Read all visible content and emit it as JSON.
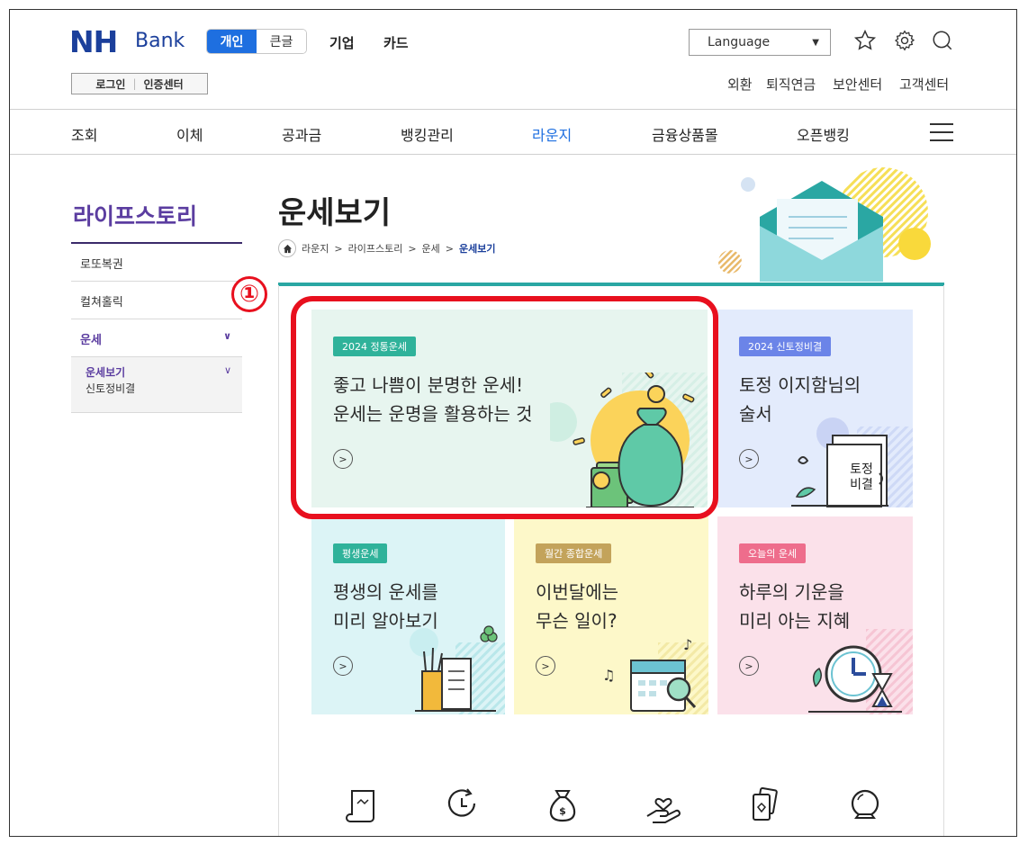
{
  "header": {
    "logo_nh": "NH",
    "logo_bank": "Bank",
    "mode_personal": "개인",
    "mode_large_text": "큰글",
    "top_links": [
      "기업",
      "카드"
    ],
    "login": "로그인",
    "cert_center": "인증센터",
    "language": "Language",
    "util_links": [
      "외환",
      "퇴직연금",
      "보안센터",
      "고객센터"
    ]
  },
  "gnb": {
    "items": [
      "조회",
      "이체",
      "공과금",
      "뱅킹관리",
      "라운지",
      "금융상품몰",
      "오픈뱅킹"
    ],
    "active": "라운지"
  },
  "sidebar": {
    "title": "라이프스토리",
    "items": [
      "로또복권",
      "컬쳐홀릭",
      "운세"
    ],
    "sub_items": [
      "운세보기",
      "신토정비결"
    ]
  },
  "main": {
    "title": "운세보기",
    "breadcrumb": [
      "라운지",
      "라이프스토리",
      "운세",
      "운세보기"
    ],
    "annotation_number": "①",
    "cards": [
      {
        "badge": "2024 정통운세",
        "text": "좋고 나쁨이 분명한 운세!\n운세는 운명을 활용하는 것",
        "bg": "#e7f5ef",
        "badge_color": "#2fb29a"
      },
      {
        "badge": "2024 신토정비결",
        "text": "토정 이지함님의\n술서",
        "bg": "#e3ebfc",
        "badge_color": "#6b84e8",
        "illus_label": "토정\n비결"
      },
      {
        "badge": "평생운세",
        "text": "평생의 운세를\n미리 알아보기",
        "bg": "#dcf4f6",
        "badge_color": "#2fb29a"
      },
      {
        "badge": "월간 종합운세",
        "text": "이번달에는\n무슨 일이?",
        "bg": "#fdf8c9",
        "badge_color": "#c3a35b"
      },
      {
        "badge": "오늘의 운세",
        "text": "하루의 기운을\n미리 아는 지혜",
        "bg": "#fbe1ea",
        "badge_color": "#ee6d8c"
      }
    ]
  },
  "colors": {
    "brand_blue": "#1b3f9b",
    "accent_blue": "#1e6fe0",
    "sidebar_purple": "#5b3da0",
    "teal_line": "#2aa7a3",
    "annotation_red": "#e8101e"
  }
}
